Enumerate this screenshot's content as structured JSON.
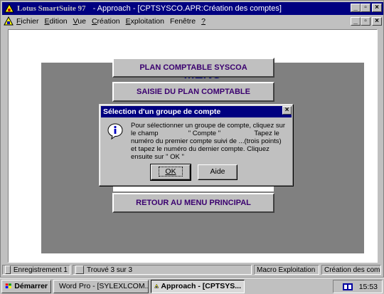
{
  "window": {
    "title_app": "Lotus SmartSuite 97",
    "title_doc": " -  Approach - [CPTSYSCO.APR:Création des comptes]",
    "controls": [
      "_",
      "▫",
      "×"
    ]
  },
  "menubar": {
    "items": [
      {
        "underline": "F",
        "rest": "ichier"
      },
      {
        "underline": "E",
        "rest": "dition"
      },
      {
        "underline": "V",
        "rest": "ue"
      },
      {
        "underline": "C",
        "rest": "réation"
      },
      {
        "underline": "E",
        "rest": "xploitation"
      },
      {
        "underline": "",
        "rest": "Fenêtre"
      },
      {
        "underline": "?",
        "rest": ""
      }
    ]
  },
  "form": {
    "title": "MENU",
    "button1": "PLAN COMPTABLE SYSCOA",
    "button2": "SAISIE DU PLAN COMPTABLE",
    "button3": "RETOUR AU MENU PRINCIPAL"
  },
  "dialog": {
    "title": "Sélection d'un groupe de compte",
    "close": "×",
    "message": "Pour sélectionner un groupe de compte, cliquez sur le champ                \" Compte \"                  Tapez le numéro du premier compte suivi de ...(trois points) et tapez le numéro du dernier compte. Cliquez ensuite sur \" OK \"",
    "ok_label": "OK",
    "help_label": "Aide",
    "icon": "info-icon"
  },
  "statusbar": {
    "record": "Enregistrement 1",
    "found": "Trouvé 3 sur 3",
    "macro": "Macro Exploitation",
    "view": "Création des comptes"
  },
  "taskbar": {
    "start": "Démarrer",
    "task1": "Word Pro - [SYLEXLCOM...",
    "task2": "Approach - [CPTSYS...",
    "time": "15:53"
  },
  "colors": {
    "titlebar": "#000080",
    "form_background": "#808080",
    "menu_title": "#000080",
    "button_text": "#3a006f"
  }
}
